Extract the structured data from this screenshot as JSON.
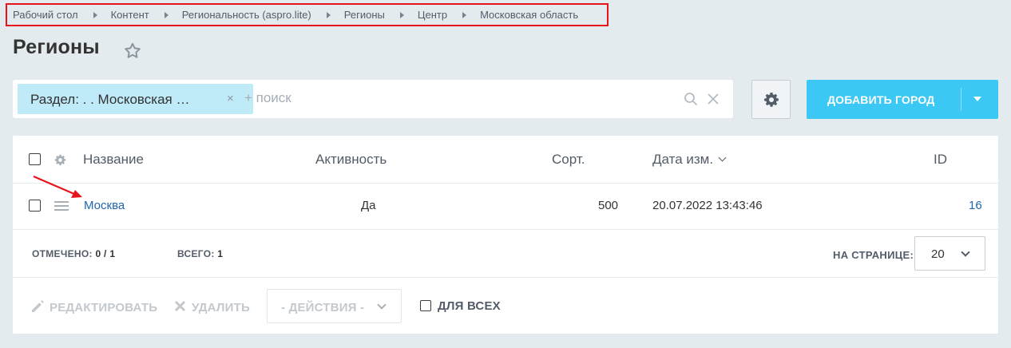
{
  "breadcrumb": {
    "items": [
      "Рабочий стол",
      "Контент",
      "Региональность (aspro.lite)",
      "Регионы",
      "Центр",
      "Московская область"
    ]
  },
  "page": {
    "title": "Регионы"
  },
  "filter": {
    "tag_label": "Раздел: . . Московская …",
    "tag_close": "×",
    "placeholder": "+ поиск"
  },
  "toolbar": {
    "add_label": "ДОБАВИТЬ ГОРОД"
  },
  "grid": {
    "columns": {
      "name": "Название",
      "active": "Активность",
      "sort": "Сорт.",
      "date": "Дата изм.",
      "id": "ID"
    },
    "rows": [
      {
        "name": "Москва",
        "active": "Да",
        "sort": "500",
        "date": "20.07.2022 13:43:46",
        "id": "16"
      }
    ],
    "footer": {
      "selected_label": "ОТМЕЧЕНО:",
      "selected_value": "0 / 1",
      "total_label": "ВСЕГО:",
      "total_value": "1",
      "per_page_label": "НА СТРАНИЦЕ:",
      "per_page_value": "20"
    },
    "actions": {
      "edit": "РЕДАКТИРОВАТЬ",
      "delete": "УДАЛИТЬ",
      "actions_select": "- ДЕЙСТВИЯ -",
      "for_all": "ДЛЯ ВСЕХ"
    }
  },
  "colors": {
    "accent": "#3bc8f5",
    "tag_bg": "#bfeaf7",
    "link": "#2067b0",
    "highlight": "#e8141b",
    "background": "#e4ebee"
  },
  "icons": [
    "star-icon",
    "search-icon",
    "clear-icon",
    "gear-icon",
    "chevron-down-icon",
    "drag-handle-icon",
    "pencil-icon",
    "delete-x-icon",
    "annotation-arrow"
  ]
}
